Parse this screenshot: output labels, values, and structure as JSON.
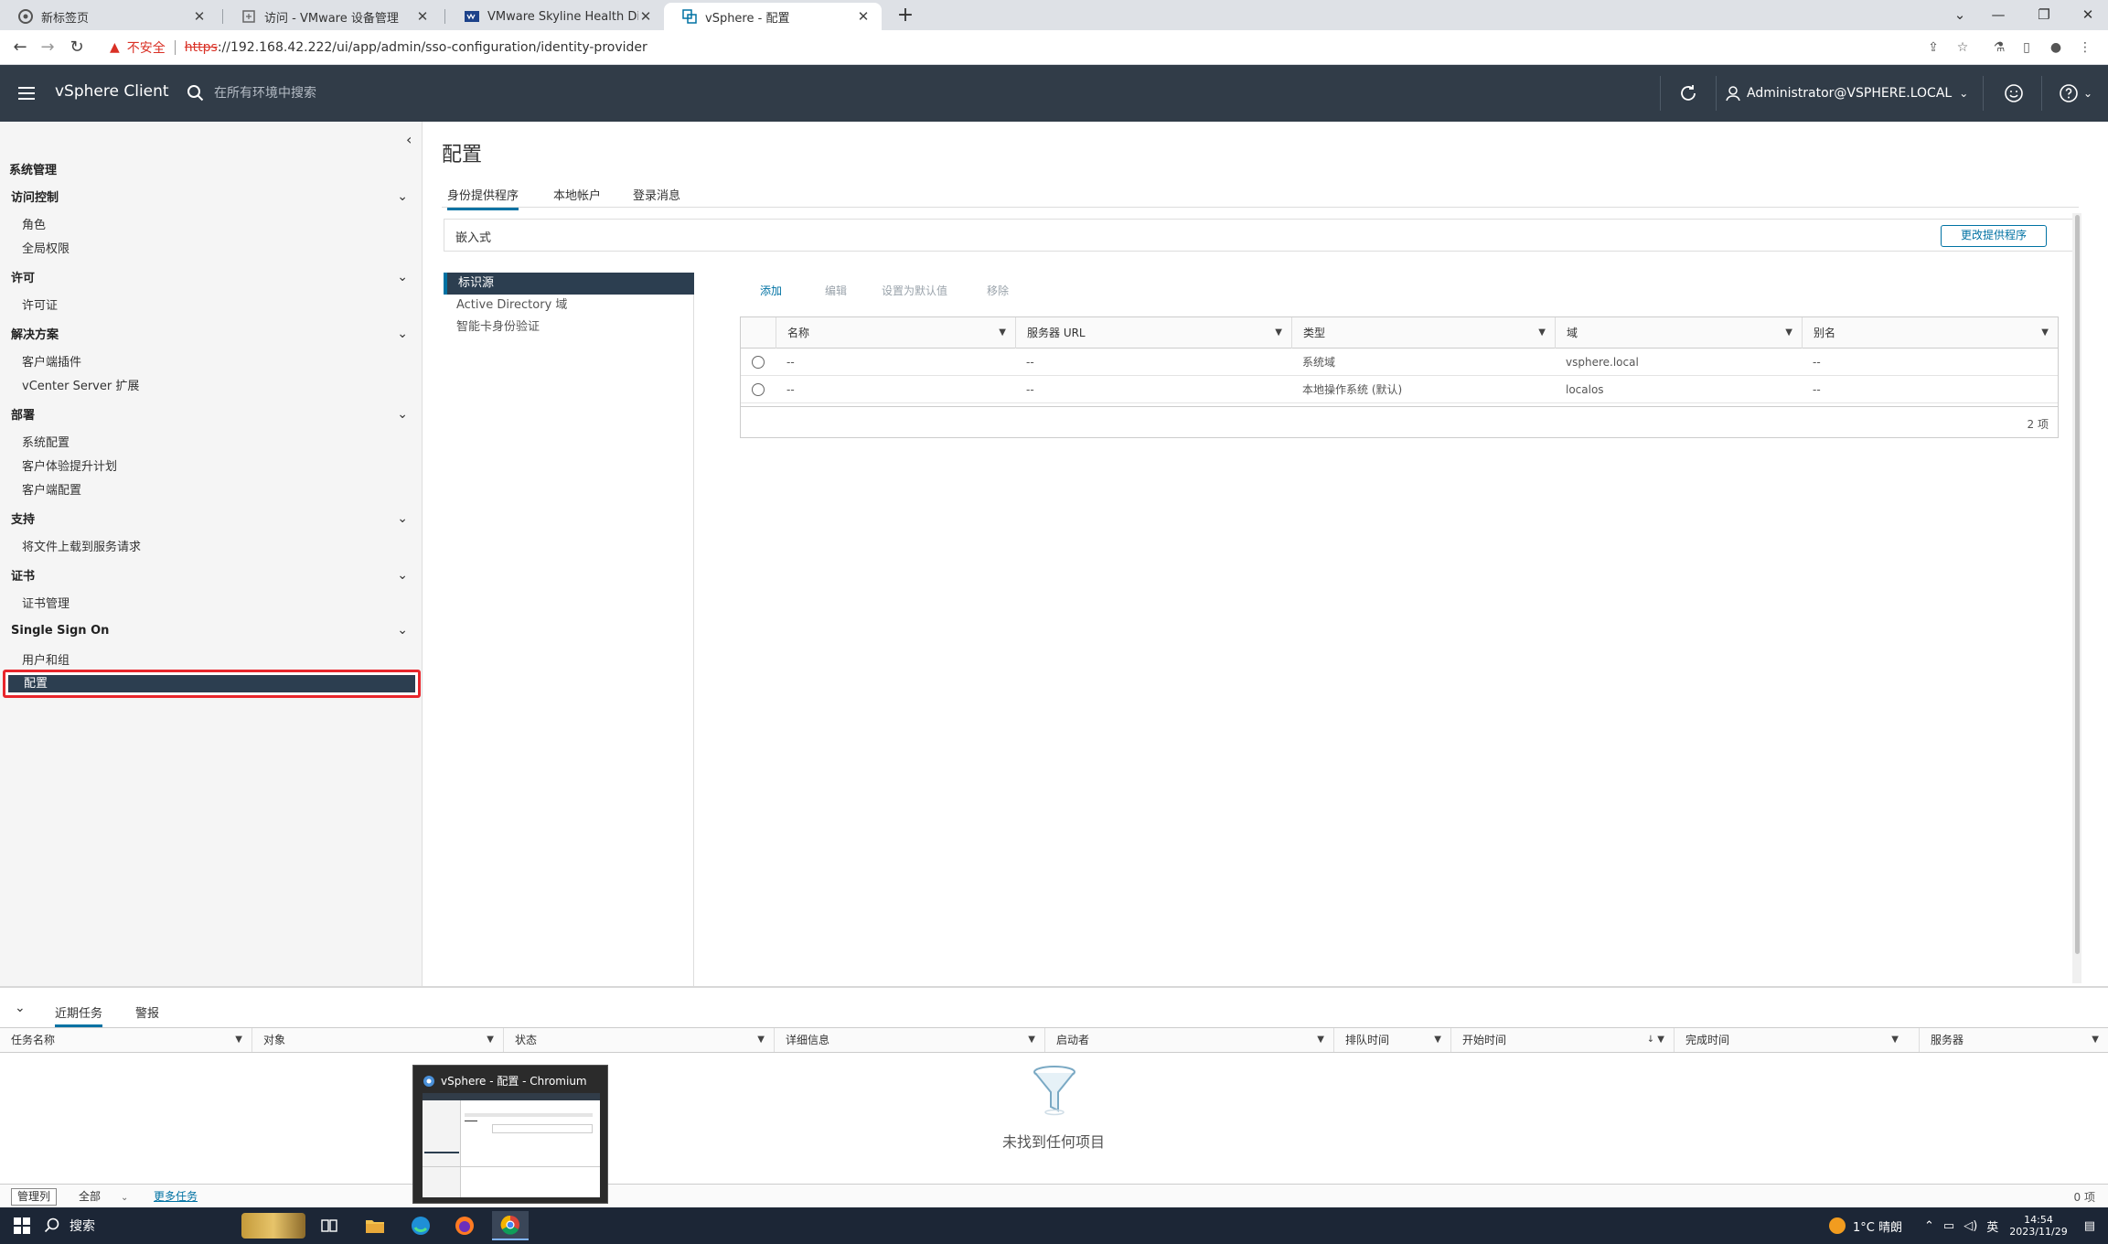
{
  "browser": {
    "tabs": [
      {
        "title": "新标签页",
        "active": false
      },
      {
        "title": "访问 - VMware 设备管理",
        "active": false
      },
      {
        "title": "VMware Skyline Health Diagno",
        "active": false
      },
      {
        "title": "vSphere - 配置",
        "active": true
      }
    ],
    "insecure_label": "不安全",
    "url_scheme": "https",
    "url_rest": "://192.168.42.222/ui/app/admin/sso-configuration/identity-provider"
  },
  "header": {
    "app_name": "vSphere Client",
    "search_placeholder": "在所有环境中搜索",
    "user": "Administrator@VSPHERE.LOCAL"
  },
  "sidebar": {
    "root": "系统管理",
    "groups": [
      {
        "label": "访问控制",
        "items": [
          "角色",
          "全局权限"
        ]
      },
      {
        "label": "许可",
        "items": [
          "许可证"
        ]
      },
      {
        "label": "解决方案",
        "items": [
          "客户端插件",
          "vCenter Server 扩展"
        ]
      },
      {
        "label": "部署",
        "items": [
          "系统配置",
          "客户体验提升计划",
          "客户端配置"
        ]
      },
      {
        "label": "支持",
        "items": [
          "将文件上载到服务请求"
        ]
      },
      {
        "label": "证书",
        "items": [
          "证书管理"
        ]
      },
      {
        "label": "Single Sign On",
        "items": [
          "用户和组",
          "配置"
        ]
      }
    ]
  },
  "main": {
    "title": "配置",
    "tabs": [
      "身份提供程序",
      "本地帐户",
      "登录消息"
    ],
    "provider_type": "嵌入式",
    "change_provider_button": "更改提供程序",
    "subnav": [
      "标识源",
      "Active Directory 域",
      "智能卡身份验证"
    ],
    "actions": {
      "add": "添加",
      "edit": "编辑",
      "set_default": "设置为默认值",
      "remove": "移除"
    },
    "grid": {
      "columns": [
        "名称",
        "服务器 URL",
        "类型",
        "域",
        "别名"
      ],
      "rows": [
        [
          "--",
          "--",
          "系统域",
          "vsphere.local",
          "--"
        ],
        [
          "--",
          "--",
          "本地操作系统 (默认)",
          "localos",
          "--"
        ]
      ],
      "footer": "2 项"
    }
  },
  "tasks": {
    "tabs": [
      "近期任务",
      "警报"
    ],
    "columns": [
      "任务名称",
      "对象",
      "状态",
      "详细信息",
      "启动者",
      "排队时间",
      "开始时间",
      "完成时间",
      "服务器"
    ],
    "empty_text": "未找到任何项目",
    "manage_columns": "管理列",
    "filter": "全部",
    "more_tasks": "更多任务",
    "count": "0 项"
  },
  "thumbnail": {
    "title": "vSphere - 配置 - Chromium"
  },
  "taskbar": {
    "search": "搜索",
    "weather": "1°C  晴朗",
    "time": "14:54",
    "date": "2023/11/29"
  },
  "colors": {
    "header_bg": "#313c48",
    "accent": "#0072a3",
    "active_nav": "#2c3e50",
    "highlight_border": "#e8262c"
  }
}
